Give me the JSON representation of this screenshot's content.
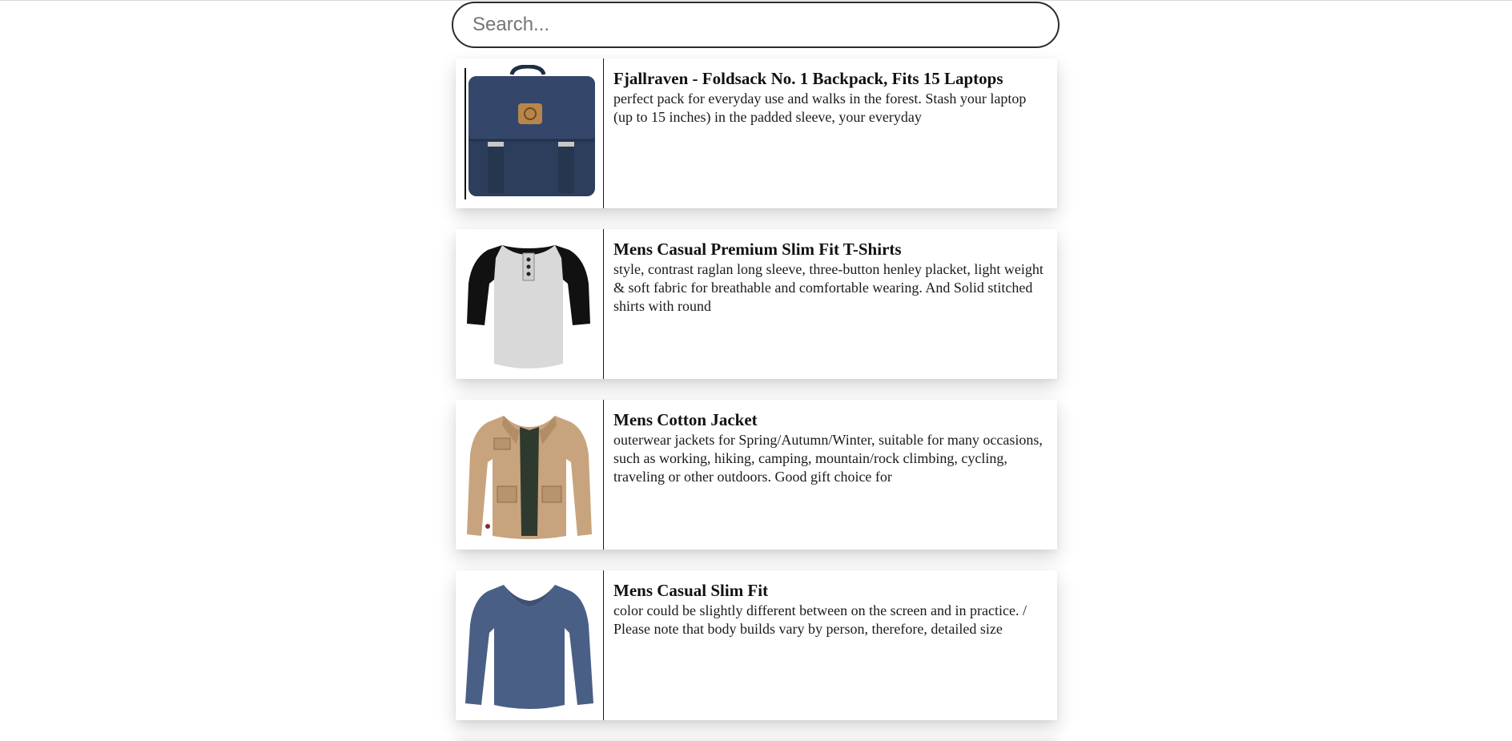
{
  "search": {
    "placeholder": "Search..."
  },
  "products": [
    {
      "title": "Fjallraven - Foldsack No. 1 Backpack, Fits 15 Laptops",
      "description": "perfect pack for everyday use and walks in the forest. Stash your laptop (up to 15 inches) in the padded sleeve, your everyday",
      "image": "backpack-image"
    },
    {
      "title": "Mens Casual Premium Slim Fit T-Shirts",
      "description": "style, contrast raglan long sleeve, three-button henley placket, light weight & soft fabric for breathable and comfortable wearing. And Solid stitched shirts with round",
      "image": "tshirt-image"
    },
    {
      "title": "Mens Cotton Jacket",
      "description": "outerwear jackets for Spring/Autumn/Winter, suitable for many occasions, such as working, hiking, camping, mountain/rock climbing, cycling, traveling or other outdoors. Good gift choice for",
      "image": "jacket-image"
    },
    {
      "title": "Mens Casual Slim Fit",
      "description": "color could be slightly different between on the screen and in practice. / Please note that body builds vary by person, therefore, detailed size",
      "image": "longsleeve-image"
    }
  ],
  "colors": {
    "backpack": "#2c3e5c",
    "tshirt_body": "#d9d9d9",
    "tshirt_sleeves": "#111111",
    "jacket": "#c8a47e",
    "longsleeve": "#4a5f85"
  }
}
